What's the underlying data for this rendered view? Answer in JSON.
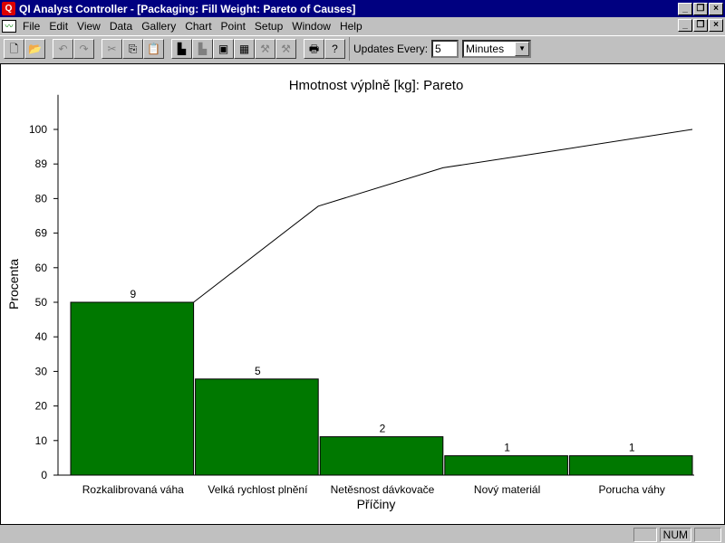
{
  "window": {
    "title": "QI Analyst Controller - [Packaging: Fill Weight: Pareto of Causes]",
    "app_icon": "Q"
  },
  "menu": [
    "File",
    "Edit",
    "View",
    "Data",
    "Gallery",
    "Chart",
    "Point",
    "Setup",
    "Window",
    "Help"
  ],
  "toolbar": {
    "buttons": [
      {
        "name": "new-icon",
        "glyph": "🗋",
        "enabled": true
      },
      {
        "name": "open-icon",
        "glyph": "📂",
        "enabled": true
      },
      {
        "name": "undo-icon",
        "glyph": "↶",
        "enabled": false
      },
      {
        "name": "redo-icon",
        "glyph": "↷",
        "enabled": false
      },
      {
        "name": "cut-icon",
        "glyph": "✂",
        "enabled": false
      },
      {
        "name": "copy-icon",
        "glyph": "⎘",
        "enabled": true
      },
      {
        "name": "paste-icon",
        "glyph": "📋",
        "enabled": false
      },
      {
        "name": "new-chart-icon",
        "glyph": "▙",
        "enabled": true
      },
      {
        "name": "chart-icon",
        "glyph": "▙",
        "enabled": false
      },
      {
        "name": "window-icon",
        "glyph": "▣",
        "enabled": true
      },
      {
        "name": "table-icon",
        "glyph": "▦",
        "enabled": true
      },
      {
        "name": "tool-icon",
        "glyph": "⚒",
        "enabled": false
      },
      {
        "name": "tool2-icon",
        "glyph": "⚒",
        "enabled": false
      },
      {
        "name": "print-icon",
        "glyph": "🖶",
        "enabled": true
      },
      {
        "name": "help-icon",
        "glyph": "?",
        "enabled": true
      }
    ],
    "updates_label": "Updates Every:",
    "updates_value": "5",
    "updates_unit": "Minutes"
  },
  "status": {
    "num": "NUM"
  },
  "chart_data": {
    "type": "bar",
    "title": "Hmotnost výplně [kg]: Pareto",
    "xlabel": "Příčiny",
    "ylabel": "Procenta",
    "categories": [
      "Rozkalibrovaná váha",
      "Velká rychlost plnění",
      "Netěsnost dávkovače",
      "Nový materiál",
      "Porucha váhy"
    ],
    "counts": [
      9,
      5,
      2,
      1,
      1
    ],
    "percent": [
      50,
      27.8,
      11.1,
      5.6,
      5.6
    ],
    "cumulative": [
      50,
      77.8,
      88.9,
      94.4,
      100
    ],
    "yticks": [
      0,
      10,
      20,
      30,
      40,
      50,
      60,
      69,
      80,
      89,
      100
    ],
    "ylim": [
      0,
      110
    ],
    "bar_color": "#007800",
    "line_color": "#000000",
    "grid": false
  }
}
